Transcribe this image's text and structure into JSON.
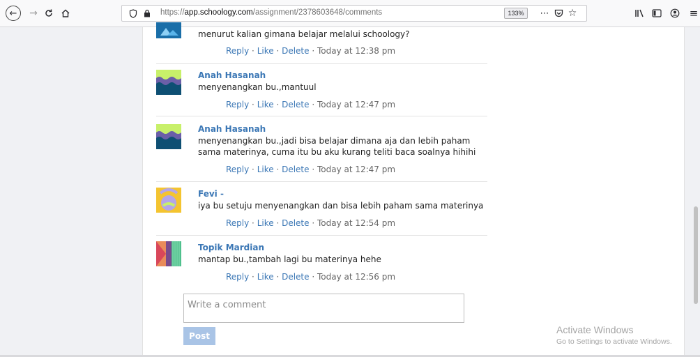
{
  "browser": {
    "url_prefix": "https://",
    "url_host": "app.schoology.com",
    "url_path": "/assignment/2378603648/comments",
    "zoom": "133%"
  },
  "icons": {
    "back": "back-arrow-icon",
    "forward": "forward-arrow-icon",
    "reload": "reload-icon",
    "home": "home-icon",
    "shield": "tracking-shield-icon",
    "lock": "lock-icon",
    "more": "more-icon",
    "pocket": "pocket-icon",
    "bookmark": "star-icon",
    "library": "library-icon",
    "sidebar": "sidebar-icon",
    "account": "account-icon",
    "menu": "menu-icon"
  },
  "actions": {
    "reply": "Reply",
    "like": "Like",
    "delete": "Delete",
    "sep": " · "
  },
  "comments": [
    {
      "name": "",
      "text": "menurut kalian gimana belajar melalui schoology?",
      "time": "Today at 12:38 pm"
    },
    {
      "name": "Anah Hasanah",
      "text": "menyenangkan bu.,mantuul",
      "time": "Today at 12:47 pm"
    },
    {
      "name": "Anah Hasanah",
      "text": "menyenangkan bu.,jadi bisa belajar dimana aja dan lebih paham sama materinya, cuma itu bu aku kurang teliti baca soalnya hihihi",
      "time": "Today at 12:47 pm"
    },
    {
      "name": "Fevi -",
      "text": "iya bu setuju menyenangkan dan bisa lebih paham sama materinya",
      "time": "Today at 12:54 pm"
    },
    {
      "name": "Topik Mardian",
      "text": "mantap bu.,tambah lagi bu materinya hehe",
      "time": "Today at 12:56 pm"
    }
  ],
  "compose": {
    "placeholder": "Write a comment",
    "post_label": "Post"
  },
  "watermark": {
    "title": "Activate Windows",
    "subtitle": "Go to Settings to activate Windows."
  },
  "colors": {
    "link": "#3b77b5",
    "post_button": "#a9c4e6"
  }
}
